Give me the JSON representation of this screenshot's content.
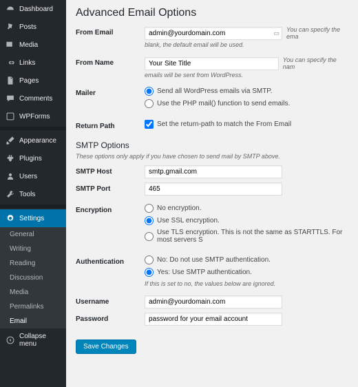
{
  "sidebar": {
    "items": [
      {
        "label": "Dashboard",
        "icon": "dashboard"
      },
      {
        "label": "Posts",
        "icon": "pin"
      },
      {
        "label": "Media",
        "icon": "media"
      },
      {
        "label": "Links",
        "icon": "link"
      },
      {
        "label": "Pages",
        "icon": "page"
      },
      {
        "label": "Comments",
        "icon": "comment"
      },
      {
        "label": "WPForms",
        "icon": "form"
      }
    ],
    "items2": [
      {
        "label": "Appearance",
        "icon": "brush"
      },
      {
        "label": "Plugins",
        "icon": "plugin"
      },
      {
        "label": "Users",
        "icon": "users"
      },
      {
        "label": "Tools",
        "icon": "tools"
      }
    ],
    "settings_label": "Settings",
    "submenu": [
      "General",
      "Writing",
      "Reading",
      "Discussion",
      "Media",
      "Permalinks",
      "Email"
    ],
    "submenu_active": 6,
    "collapse": "Collapse menu"
  },
  "page": {
    "title": "Advanced Email Options",
    "from_email": {
      "label": "From Email",
      "value": "admin@yourdomain.com",
      "side": "You can specify the ema",
      "note": "blank, the default email will be used."
    },
    "from_name": {
      "label": "From Name",
      "value": "Your Site Title",
      "side": "You can specify the nam",
      "note": "emails will be sent from WordPress."
    },
    "mailer": {
      "label": "Mailer",
      "opt1": "Send all WordPress emails via SMTP.",
      "opt2": "Use the PHP mail() function to send emails."
    },
    "return_path": {
      "label": "Return Path",
      "opt": "Set the return-path to match the From Email"
    },
    "smtp_title": "SMTP Options",
    "smtp_desc": "These options only apply if you have chosen to send mail by SMTP above.",
    "smtp_host": {
      "label": "SMTP Host",
      "value": "smtp.gmail.com"
    },
    "smtp_port": {
      "label": "SMTP Port",
      "value": "465"
    },
    "encryption": {
      "label": "Encryption",
      "opt1": "No encryption.",
      "opt2": "Use SSL encryption.",
      "opt3": "Use TLS encryption. This is not the same as STARTTLS. For most servers S"
    },
    "auth": {
      "label": "Authentication",
      "opt1": "No: Do not use SMTP authentication.",
      "opt2": "Yes: Use SMTP authentication.",
      "note": "If this is set to no, the values below are ignored."
    },
    "username": {
      "label": "Username",
      "value": "admin@yourdomain.com"
    },
    "password": {
      "label": "Password",
      "value": "password for your email account"
    },
    "save": "Save Changes"
  }
}
